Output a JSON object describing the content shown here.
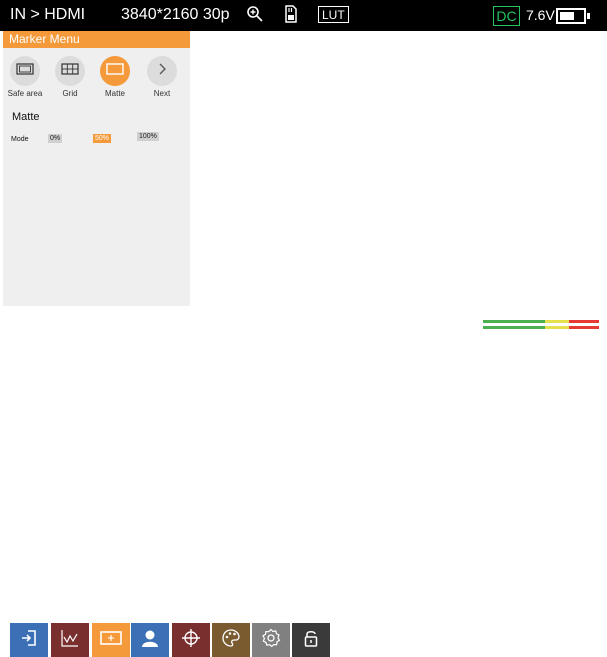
{
  "status_bar": {
    "input": "IN > HDMI",
    "resolution": "3840*2160 30p",
    "zoom_icon": "zoom-in-icon",
    "sd_icon": "sd-card-icon",
    "lut_label": "LUT",
    "power_source": "DC",
    "voltage": "7.6V",
    "battery_level": 0.65,
    "colors": {
      "background": "#000000",
      "dc": "#22c55e"
    }
  },
  "marker_menu": {
    "title": "Marker Menu",
    "items": [
      {
        "label": "Safe area",
        "icon": "safe-area-icon",
        "active": false
      },
      {
        "label": "Grid",
        "icon": "grid-icon",
        "active": false
      },
      {
        "label": "Matte",
        "icon": "matte-icon",
        "active": true
      },
      {
        "label": "Next",
        "icon": "chevron-right-icon",
        "active": false
      }
    ],
    "section_title": "Matte",
    "mode": {
      "label": "Mode",
      "options": [
        "0%",
        "50%",
        "100%"
      ],
      "selected": "50%"
    },
    "colors": {
      "accent": "#f59a3a",
      "panel": "#efefef"
    }
  },
  "toolbar": {
    "buttons": [
      {
        "name": "input-icon",
        "color": "#3b6fb6"
      },
      {
        "name": "waveform-icon",
        "color": "#7a2f2f"
      },
      {
        "name": "marker-icon",
        "color": "#f59a3a"
      },
      {
        "name": "user-icon",
        "color": "#3b6fb6"
      },
      {
        "name": "crosshair-icon",
        "color": "#7a2f2f"
      },
      {
        "name": "palette-icon",
        "color": "#7a5a2f"
      },
      {
        "name": "settings-icon",
        "color": "#808080"
      },
      {
        "name": "lock-icon",
        "color": "#3a3a3a"
      }
    ]
  },
  "audio_meter": {
    "channels": 2,
    "colors": {
      "low": "#4caf50",
      "mid": "#e6e04a",
      "high": "#e53935"
    }
  }
}
